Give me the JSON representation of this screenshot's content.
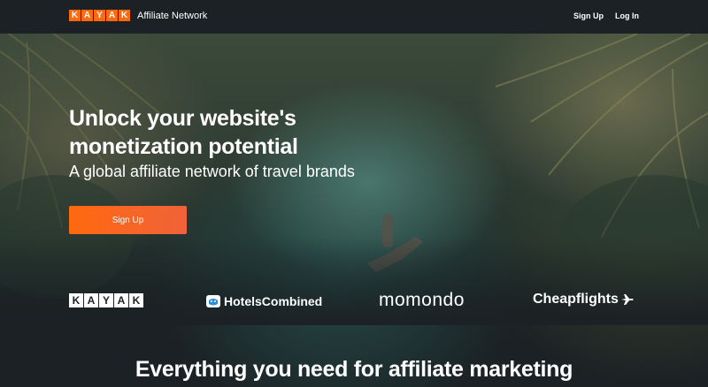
{
  "header": {
    "brand_letters": [
      "K",
      "A",
      "Y",
      "A",
      "K"
    ],
    "brand_sub": "Affiliate Network",
    "nav": {
      "signup": "Sign Up",
      "login": "Log In"
    }
  },
  "hero": {
    "headline": "Unlock your website's monetization potential",
    "subline": "A global affiliate network of travel brands",
    "cta": "Sign Up"
  },
  "partners": {
    "kayak_letters": [
      "K",
      "A",
      "Y",
      "A",
      "K"
    ],
    "hotelscombined": "HotelsCombined",
    "momondo": "momondo",
    "cheapflights": "Cheapflights"
  },
  "section": {
    "title": "Everything you need for affiliate marketing"
  },
  "colors": {
    "accent": "#ff690f",
    "background": "#1b2124",
    "text": "#ffffff"
  },
  "icons": {
    "plane": "airplane-icon",
    "hc": "hotelscombined-icon"
  }
}
